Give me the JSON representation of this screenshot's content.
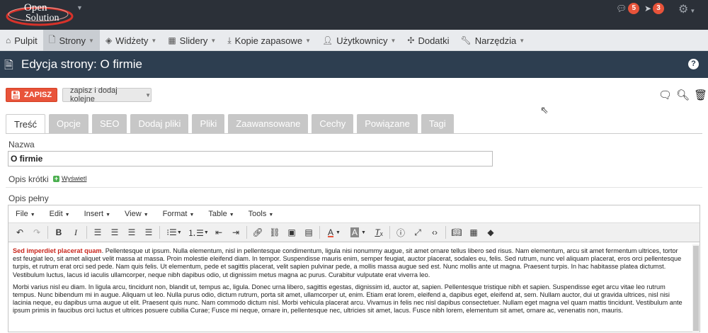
{
  "topbar": {
    "logo_line1": "Open",
    "logo_line2": "Solution",
    "comments_count": "5",
    "notifications_count": "3"
  },
  "nav": {
    "items": [
      {
        "label": "Pulpit",
        "icon": "home-icon",
        "dropdown": false,
        "active": false
      },
      {
        "label": "Strony",
        "icon": "document-icon",
        "dropdown": true,
        "active": true
      },
      {
        "label": "Widżety",
        "icon": "cube-icon",
        "dropdown": true,
        "active": false
      },
      {
        "label": "Slidery",
        "icon": "film-icon",
        "dropdown": true,
        "active": false
      },
      {
        "label": "Kopie zapasowe",
        "icon": "download-icon",
        "dropdown": true,
        "active": false
      },
      {
        "label": "Użytkownicy",
        "icon": "user-icon",
        "dropdown": true,
        "active": false
      },
      {
        "label": "Dodatki",
        "icon": "puzzle-icon",
        "dropdown": false,
        "active": false
      },
      {
        "label": "Narzędzia",
        "icon": "wrench-icon",
        "dropdown": true,
        "active": false
      }
    ]
  },
  "page": {
    "title": "Edycja strony: O firmie"
  },
  "actions": {
    "save_label": "ZAPISZ",
    "save_add_label": "zapisz i dodaj kolejne"
  },
  "tabs": [
    "Treść",
    "Opcje",
    "SEO",
    "Dodaj pliki",
    "Pliki",
    "Zaawansowane",
    "Cechy",
    "Powiązane",
    "Tagi"
  ],
  "form": {
    "name_label": "Nazwa",
    "name_value": "O firmie",
    "short_desc_label": "Opis krótki",
    "show_link": "Wyświetl",
    "full_desc_label": "Opis pełny"
  },
  "editor": {
    "menu": [
      "File",
      "Edit",
      "Insert",
      "View",
      "Format",
      "Table",
      "Tools"
    ],
    "lead": "Sed imperdiet placerat quam",
    "paragraph1": ". Pellentesque ut ipsum. Nulla elementum, nisl in pellentesque condimentum, ligula nisi nonummy augue, sit amet ornare tellus libero sed risus. Nam elementum, arcu sit amet fermentum ultrices, tortor est feugiat leo, sit amet aliquet velit massa at massa. Proin molestie eleifend diam. In tempor. Suspendisse mauris enim, semper feugiat, auctor placerat, sodales eu, felis. Sed rutrum, nunc vel aliquam placerat, eros orci pellentesque turpis, et rutrum erat orci sed pede. Nam quis felis. Ut elementum, pede et sagittis placerat, velit sapien pulvinar pede, a mollis massa augue sed est. Nunc mollis ante ut magna. Praesent turpis. In hac habitasse platea dictumst. Vestibulum luctus, lacus id iaculis ullamcorper, neque nibh dapibus odio, ut dignissim metus magna ac purus. Curabitur vulputate erat viverra leo.",
    "paragraph2": "Morbi varius nisl eu diam. In ligula arcu, tincidunt non, blandit ut, tempus ac, ligula. Donec urna libero, sagittis egestas, dignissim id, auctor at, sapien. Pellentesque tristique nibh et sapien. Suspendisse eget arcu vitae leo rutrum tempus. Nunc bibendum mi in augue. Aliquam ut leo. Nulla purus odio, dictum rutrum, porta sit amet, ullamcorper ut, enim. Etiam erat lorem, eleifend a, dapibus eget, eleifend at, sem. Nullam auctor, dui ut gravida ultrices, nisl nisi lacinia neque, eu dapibus urna augue ut elit. Praesent quis nunc. Nam commodo dictum nisl. Morbi vehicula placerat arcu. Vivamus in felis nec nisl dapibus consectetuer. Nullam eget magna vel quam mattis tincidunt. Vestibulum ante ipsum primis in faucibus orci luctus et ultrices posuere cubilia Curae; Fusce mi neque, ornare in, pellentesque nec, ultricies sit amet, lacus. Fusce nibh lorem, elementum sit amet, ornare ac, venenatis non, mauris."
  },
  "colors": {
    "topbar": "#2b3038",
    "header": "#2d3e50",
    "accent": "#e8533a"
  }
}
